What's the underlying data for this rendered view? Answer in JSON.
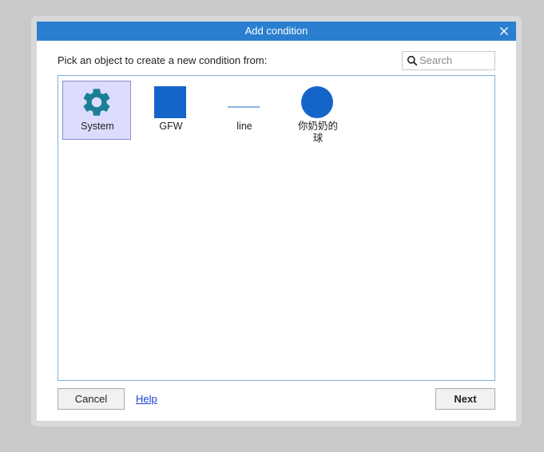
{
  "dialog": {
    "title": "Add condition",
    "prompt": "Pick an object to create a new condition from:",
    "search": {
      "placeholder": "Search",
      "value": ""
    },
    "objects": [
      {
        "label": "System",
        "icon": "gear-icon",
        "selected": true
      },
      {
        "label": "GFW",
        "icon": "blue-square-icon",
        "selected": false
      },
      {
        "label": "line",
        "icon": "line-icon",
        "selected": false
      },
      {
        "label": "你奶奶的\n球",
        "icon": "blue-circle-icon",
        "selected": false
      }
    ],
    "buttons": {
      "cancel_label": "Cancel",
      "help_label": "Help",
      "next_label": "Next"
    }
  },
  "colors": {
    "titlebar": "#2b7fd0",
    "selection_fill": "#dcdcff",
    "selection_border": "#8a8ad8",
    "object_blue": "#1565c8",
    "gear_teal": "#1b7f95",
    "list_border": "#7fb0e0",
    "link": "#1a3fd6"
  }
}
